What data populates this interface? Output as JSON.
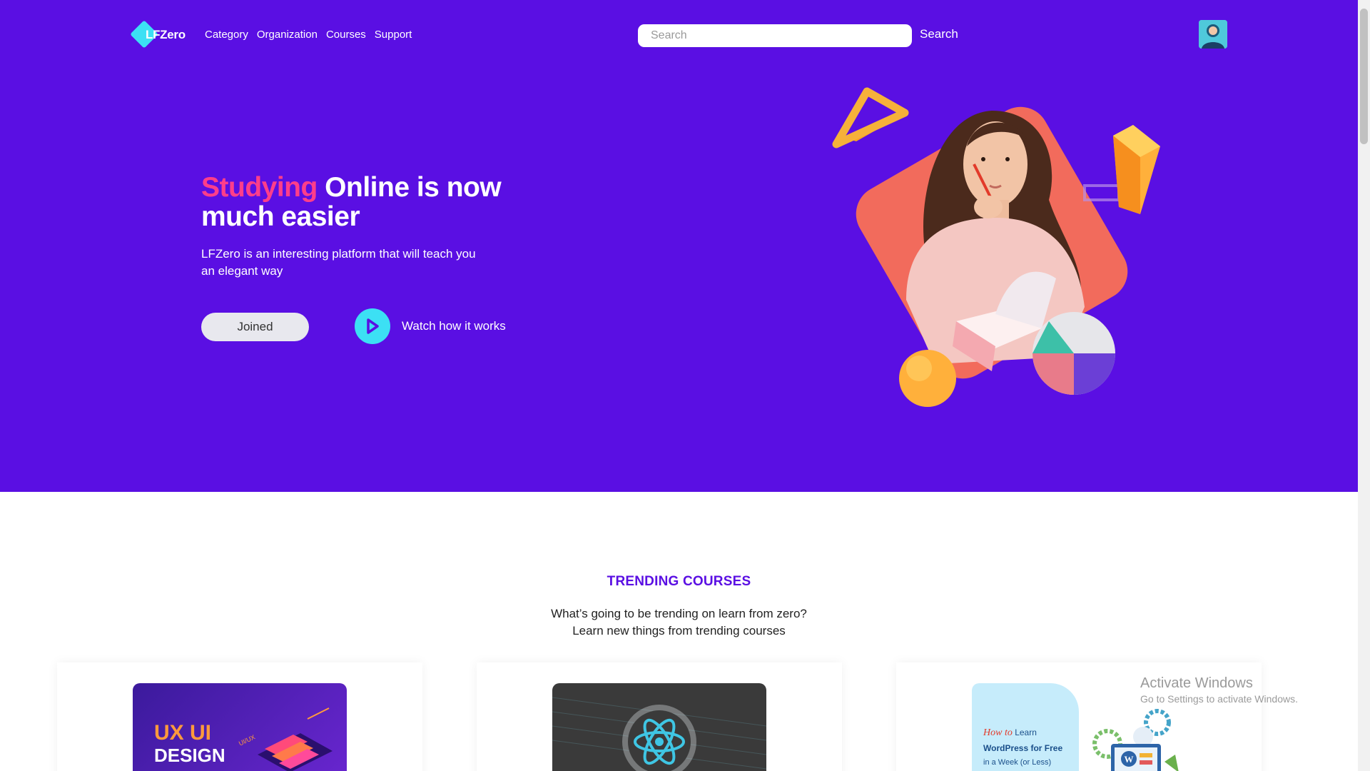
{
  "brand": {
    "logo_text": "LFZero"
  },
  "nav": {
    "items": [
      "Category",
      "Organization",
      "Courses",
      "Support"
    ]
  },
  "search": {
    "placeholder": "Search",
    "button_label": "Search"
  },
  "hero": {
    "title_accent": "Studying",
    "title_rest": " Online is now much easier",
    "subtitle": "LFZero is an interesting platform that will teach you an elegant way",
    "join_label": "Joined",
    "watch_label": "Watch how it works"
  },
  "trending": {
    "title": "TRENDING COURSES",
    "subtitle_line1": "What’s going to be trending on learn from zero?",
    "subtitle_line2": "Learn new things from trending courses",
    "cards": [
      {
        "thumb_line1": "UX UI",
        "thumb_line2": "DESIGN",
        "thumb_badge": "UI/UX"
      },
      {
        "thumb_icon": "react-atom-icon"
      },
      {
        "thumb_line1": "How to",
        "thumb_line1b": "Learn",
        "thumb_line2": "WordPress for Free",
        "thumb_line3": "in a Week (or Less)"
      }
    ]
  },
  "watermark": {
    "line1": "Activate Windows",
    "line2": "Go to Settings to activate Windows."
  },
  "colors": {
    "primary": "#5a0fe3",
    "accent_pink": "#ff3e8a",
    "accent_cyan": "#3ce0f4",
    "coral": "#f26b5c",
    "orange": "#ffb03b"
  }
}
